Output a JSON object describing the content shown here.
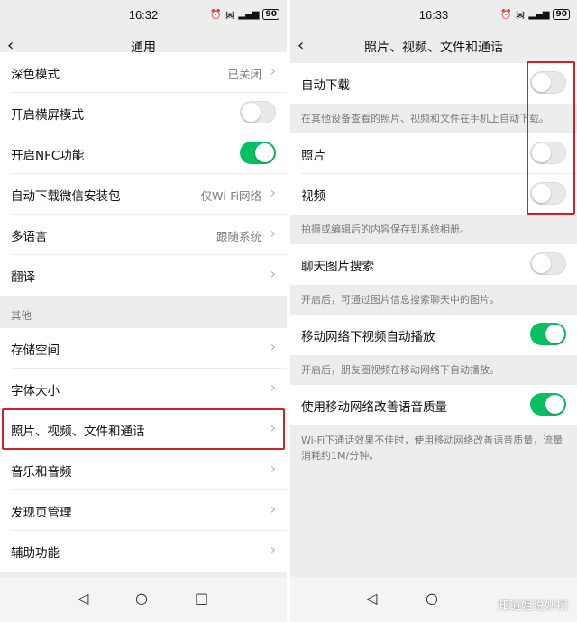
{
  "status": {
    "left_time": "16:32",
    "right_time": "16:33",
    "battery": "90"
  },
  "left": {
    "title": "通用",
    "rows_top": [
      {
        "label": "深色模式",
        "value": "已关闭",
        "type": "chevron"
      },
      {
        "label": "开启横屏模式",
        "type": "toggle",
        "on": false
      },
      {
        "label": "开启NFC功能",
        "type": "toggle",
        "on": true
      },
      {
        "label": "自动下载微信安装包",
        "value": "仅Wi-Fi网络",
        "type": "chevron"
      },
      {
        "label": "多语言",
        "value": "跟随系统",
        "type": "chevron"
      },
      {
        "label": "翻译",
        "type": "chevron"
      }
    ],
    "section_other": "其他",
    "rows_other": [
      {
        "label": "存储空间"
      },
      {
        "label": "字体大小"
      },
      {
        "label": "照片、视频、文件和通话"
      },
      {
        "label": "音乐和音频"
      },
      {
        "label": "发现页管理"
      },
      {
        "label": "辅助功能"
      }
    ]
  },
  "right": {
    "title": "照片、视频、文件和通话",
    "auto_download": "自动下载",
    "auto_download_note": "在其他设备查看的照片、视频和文件在手机上自动下载。",
    "photo": "照片",
    "video": "视频",
    "save_note": "拍摄或编辑后的内容保存到系统相册。",
    "chat_image_search": "聊天图片搜索",
    "chat_image_search_note": "开启后，可通过图片信息搜索聊天中的图片。",
    "mobile_autoplay": "移动网络下视频自动播放",
    "mobile_autoplay_note": "开启后，朋友圈视频在移动网络下自动播放。",
    "voice_quality": "使用移动网络改善语音质量",
    "voice_quality_note": "Wi-Fi下通话效果不佳时，使用移动网络改善语音质量，流量消耗约1M/分钟。",
    "toggles": {
      "auto_download": false,
      "photo": false,
      "video": false,
      "chat_image_search": false,
      "mobile_autoplay": true,
      "voice_quality": true
    }
  },
  "nav": {
    "back_icon": "back-triangle-icon",
    "home_icon": "home-circle-icon",
    "recent_icon": "recent-square-icon"
  },
  "watermark": "知道姐说妙招",
  "colors": {
    "accent": "#07c160",
    "highlight": "#d32027"
  }
}
